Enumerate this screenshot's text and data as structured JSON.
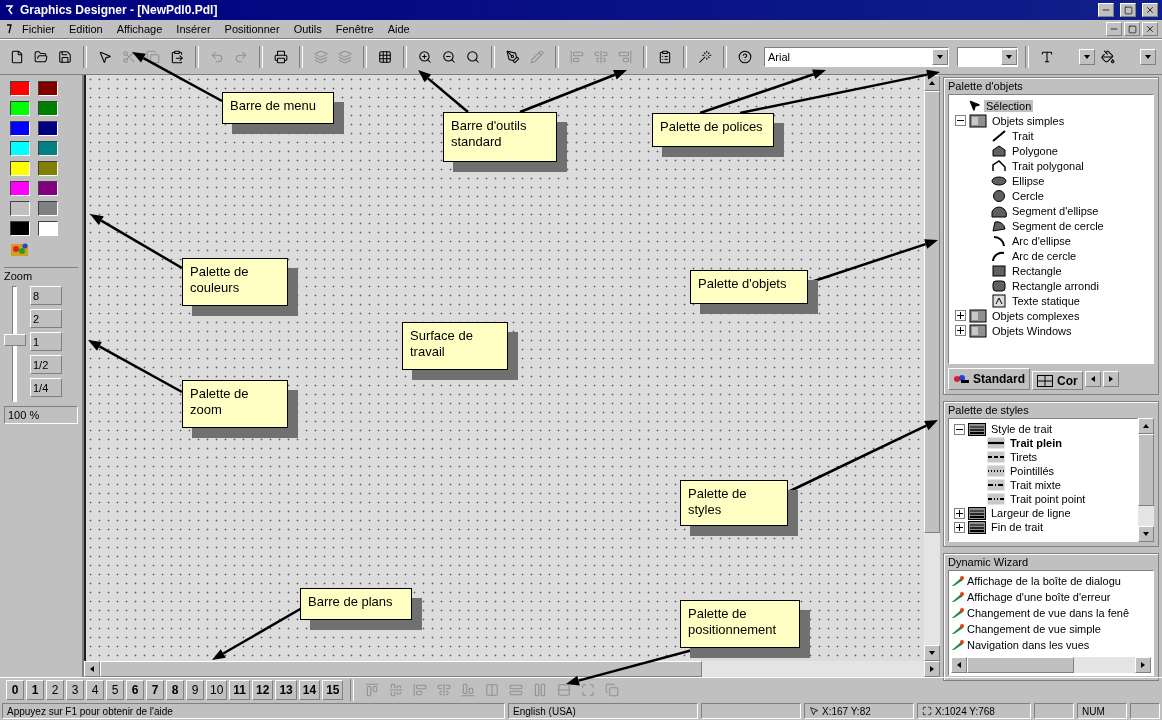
{
  "window": {
    "title": "Graphics Designer - [NewPdl0.Pdl]"
  },
  "menu": [
    "Fichier",
    "Edition",
    "Affichage",
    "Insérer",
    "Positionner",
    "Outils",
    "Fenêtre",
    "Aide"
  ],
  "toolbar": {
    "font": "Arial"
  },
  "color_palette": [
    {
      "color": "#ff0000"
    },
    {
      "color": "#800000"
    },
    {
      "color": "#00ff00"
    },
    {
      "color": "#008000"
    },
    {
      "color": "#0000ff"
    },
    {
      "color": "#000080"
    },
    {
      "color": "#00ffff"
    },
    {
      "color": "#008080"
    },
    {
      "color": "#ffff00"
    },
    {
      "color": "#808000"
    },
    {
      "color": "#ff00ff"
    },
    {
      "color": "#800080"
    },
    {
      "color": "#c0c0c0"
    },
    {
      "color": "#808080"
    },
    {
      "color": "#000000"
    },
    {
      "color": "#ffffff"
    }
  ],
  "zoom": {
    "title": "Zoom",
    "level": 0.55,
    "buttons": [
      "8",
      "2",
      "1",
      "1/2",
      "1/4"
    ],
    "value": "100 %"
  },
  "object_palette": {
    "title": "Palette d'objets",
    "tree": [
      {
        "label": "Sélection",
        "selected": true
      },
      {
        "label": "Objets simples",
        "selected": false,
        "expanded": true,
        "children": [
          {
            "label": "Trait",
            "selected": false
          },
          {
            "label": "Polygone",
            "selected": false
          },
          {
            "label": "Trait polygonal",
            "selected": false
          },
          {
            "label": "Ellipse",
            "selected": false
          },
          {
            "label": "Cercle",
            "selected": false
          },
          {
            "label": "Segment d'ellipse",
            "selected": false
          },
          {
            "label": "Segment de cercle",
            "selected": false
          },
          {
            "label": "Arc d'ellipse",
            "selected": false
          },
          {
            "label": "Arc de cercle",
            "selected": false
          },
          {
            "label": "Rectangle",
            "selected": false
          },
          {
            "label": "Rectangle arrondi",
            "selected": false
          },
          {
            "label": "Texte statique",
            "selected": false
          }
        ]
      },
      {
        "label": "Objets complexes",
        "selected": false,
        "expanded": false
      },
      {
        "label": "Objets Windows",
        "selected": false,
        "expanded": false
      }
    ],
    "tabs": [
      {
        "label": "Standard",
        "selected": true
      },
      {
        "label": "Cor",
        "selected": false
      }
    ]
  },
  "style_palette": {
    "title": "Palette de styles",
    "tree": [
      {
        "label": "Style de trait",
        "expanded": true,
        "children": [
          {
            "label": "Trait plein",
            "current": true
          },
          {
            "label": "Tirets",
            "current": false
          },
          {
            "label": "Pointillés",
            "current": false
          },
          {
            "label": "Trait mixte",
            "current": false
          },
          {
            "label": "Trait point point",
            "current": false
          }
        ]
      },
      {
        "label": "Largeur de ligne",
        "expanded": false
      },
      {
        "label": "Fin de trait",
        "expanded": false
      }
    ]
  },
  "dynamic_wizard": {
    "title": "Dynamic Wizard",
    "items": [
      "Affichage de la boîte de dialogu",
      "Affichage d'une boîte d'erreur",
      "Changement de vue dans la fenê",
      "Changement de vue simple",
      "Navigation dans les vues"
    ]
  },
  "plane_bar": [
    {
      "label": "0",
      "active": true
    },
    {
      "label": "1",
      "active": true
    },
    {
      "label": "2",
      "active": false
    },
    {
      "label": "3",
      "active": false
    },
    {
      "label": "4",
      "active": false
    },
    {
      "label": "5",
      "active": false
    },
    {
      "label": "6",
      "active": true
    },
    {
      "label": "7",
      "active": true
    },
    {
      "label": "8",
      "active": true
    },
    {
      "label": "9",
      "active": false
    },
    {
      "label": "10",
      "active": false
    },
    {
      "label": "11",
      "active": true
    },
    {
      "label": "12",
      "active": true
    },
    {
      "label": "13",
      "active": true
    },
    {
      "label": "14",
      "active": true
    },
    {
      "label": "15",
      "active": true
    }
  ],
  "status_bar": {
    "help": "Appuyez sur F1 pour obtenir de l'aide",
    "language": "English (USA)",
    "cursor": "X:167 Y:82",
    "size": "X:1024 Y:768",
    "num": "NUM"
  },
  "callouts": [
    "Barre de menu",
    "Barre d'outils standard",
    "Palette de polices",
    "Palette de couleurs",
    "Palette de zoom",
    "Surface de travail",
    "Palette d'objets",
    "Palette de styles",
    "Barre de plans",
    "Palette de positionnement"
  ]
}
